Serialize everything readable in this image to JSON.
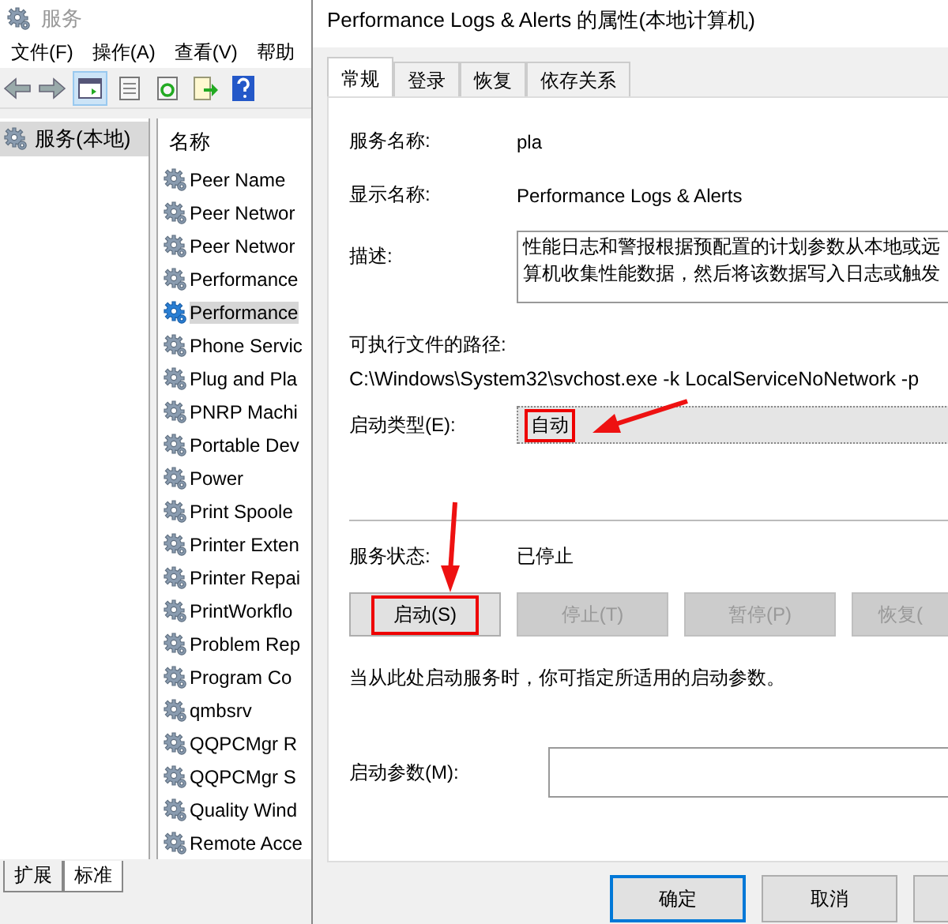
{
  "services_window": {
    "title": "服务",
    "menu": [
      "文件(F)",
      "操作(A)",
      "查看(V)",
      "帮助"
    ],
    "tree": [
      {
        "label": "服务(本地)",
        "selected": true
      }
    ],
    "list": {
      "column": "名称",
      "rows": [
        {
          "name": "Peer Name",
          "selected": false
        },
        {
          "name": "Peer Networ",
          "selected": false
        },
        {
          "name": "Peer Networ",
          "selected": false
        },
        {
          "name": "Performance",
          "selected": false
        },
        {
          "name": "Performance",
          "selected": true
        },
        {
          "name": "Phone Servic",
          "selected": false
        },
        {
          "name": "Plug and Pla",
          "selected": false
        },
        {
          "name": "PNRP Machi",
          "selected": false
        },
        {
          "name": "Portable Dev",
          "selected": false
        },
        {
          "name": "Power",
          "selected": false
        },
        {
          "name": "Print Spoole",
          "selected": false
        },
        {
          "name": "Printer Exten",
          "selected": false
        },
        {
          "name": "Printer Repai",
          "selected": false
        },
        {
          "name": "PrintWorkflo",
          "selected": false
        },
        {
          "name": "Problem Rep",
          "selected": false
        },
        {
          "name": "Program Co",
          "selected": false
        },
        {
          "name": "qmbsrv",
          "selected": false
        },
        {
          "name": "QQPCMgr R",
          "selected": false
        },
        {
          "name": "QQPCMgr S",
          "selected": false
        },
        {
          "name": "Quality Wind",
          "selected": false
        },
        {
          "name": "Remote Acce",
          "selected": false
        }
      ]
    },
    "bottom_tabs": [
      {
        "label": "扩展",
        "selected": false
      },
      {
        "label": "标准",
        "selected": true
      }
    ]
  },
  "dialog": {
    "title": "Performance Logs & Alerts 的属性(本地计算机)",
    "tabs": [
      {
        "label": "常规",
        "selected": true
      },
      {
        "label": "登录",
        "selected": false
      },
      {
        "label": "恢复",
        "selected": false
      },
      {
        "label": "依存关系",
        "selected": false
      }
    ],
    "service_name": {
      "label": "服务名称:",
      "value": "pla"
    },
    "display_name": {
      "label": "显示名称:",
      "value": "Performance Logs & Alerts"
    },
    "description": {
      "label": "描述:",
      "lines": [
        "性能日志和警报根据预配置的计划参数从本地或远",
        "算机收集性能数据，然后将该数据写入日志或触发"
      ]
    },
    "path": {
      "label": "可执行文件的路径:",
      "value": "C:\\Windows\\System32\\svchost.exe -k LocalServiceNoNetwork -p"
    },
    "startup_type": {
      "label": "启动类型(E):",
      "value": "自动"
    },
    "status": {
      "label": "服务状态:",
      "value": "已停止"
    },
    "service_buttons": [
      {
        "label": "启动(S)",
        "disabled": false
      },
      {
        "label": "停止(T)",
        "disabled": true
      },
      {
        "label": "暂停(P)",
        "disabled": true
      },
      {
        "label": "恢复(",
        "disabled": true
      }
    ],
    "note": "当从此处启动服务时，你可指定所适用的启动参数。",
    "start_params": {
      "label": "启动参数(M):"
    },
    "buttons": [
      {
        "label": "确定",
        "default": true
      },
      {
        "label": "取消",
        "default": false
      }
    ]
  }
}
